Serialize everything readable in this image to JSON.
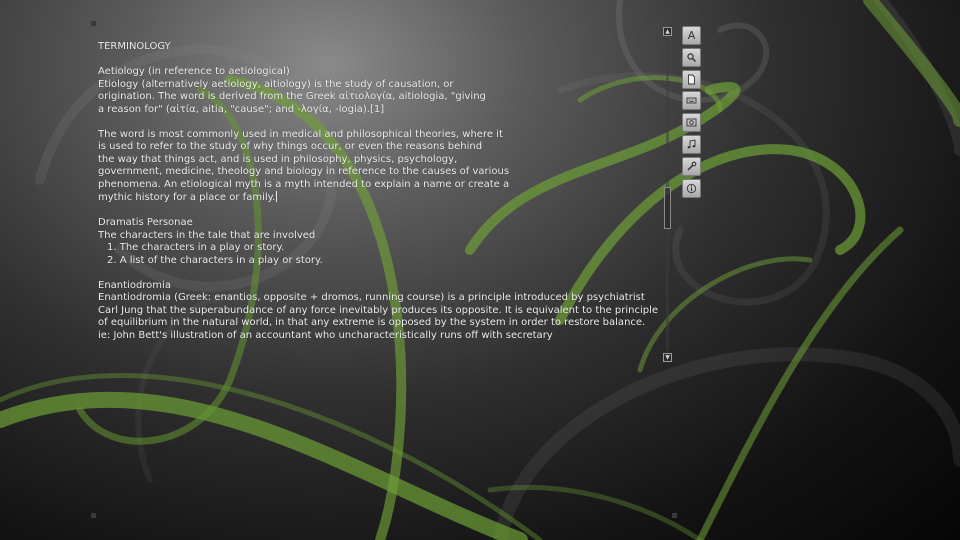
{
  "document": {
    "heading": "TERMINOLOGY",
    "sections": {
      "aetiology": {
        "title": "Aetiology (in reference to aetiological)",
        "lines": [
          "Etiology (alternatively aetiology, aitiology) is the study of causation, or",
          "origination. The word is derived from the Greek αἰτιολογία, aitiologia, \"giving",
          "a reason for\" (αἰτία, aitia, \"cause\"; and -λογία, -logia).[1]"
        ],
        "paragraph2": [
          "The word is most commonly used in medical and philosophical theories, where it",
          "is used to refer to the study of why things occur, or even the reasons behind",
          "the way that things act, and is used in philosophy, physics, psychology,",
          "government, medicine, theology and biology in reference to the causes of various",
          "phenomena. An etiological myth is a myth intended to explain a name or create a",
          "mythic history for a place or family."
        ]
      },
      "dramatis": {
        "title": "Dramatis Personae",
        "intro": "The characters in the tale that are involved",
        "items": [
          "1.  The characters in a play or story.",
          "2. A list of the characters in a play or story."
        ]
      },
      "enantiodromia": {
        "title": "Enantiodromia",
        "lines": [
          "Enantiodromia (Greek: enantios, opposite + dromos, running course) is a principle introduced by psychiatrist",
          "Carl Jung that the superabundance of any force inevitably produces its opposite. It is equivalent to the principle",
          "of equilibrium in the natural world, in that any extreme is opposed by the system in order to restore balance.",
          "ie: John Bett's illustration of an accountant who uncharacteristically runs off with secretary"
        ]
      }
    }
  },
  "scrollbar": {
    "up_glyph": "▲",
    "down_glyph": "▼",
    "position_fraction": 0.47
  },
  "toolbar": {
    "buttons": [
      {
        "name": "font-button",
        "icon": "letter-a-icon"
      },
      {
        "name": "search-button",
        "icon": "magnifier-icon"
      },
      {
        "name": "new-document-button",
        "icon": "page-icon"
      },
      {
        "name": "keyboard-button",
        "icon": "keyboard-icon"
      },
      {
        "name": "image-button",
        "icon": "picture-icon"
      },
      {
        "name": "music-button",
        "icon": "music-note-icon"
      },
      {
        "name": "tools-button",
        "icon": "wrench-icon"
      },
      {
        "name": "info-button",
        "icon": "info-icon"
      }
    ],
    "font_glyph": "A"
  },
  "colors": {
    "accent_green": "#6a9a2c",
    "text": "#ececec",
    "background_dark": "#0a0a0a"
  }
}
